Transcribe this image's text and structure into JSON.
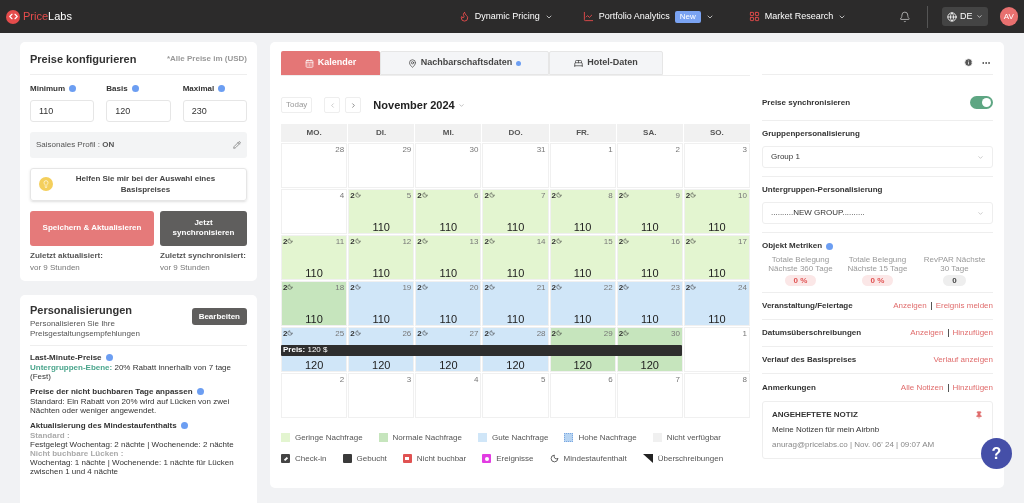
{
  "header": {
    "logo": {
      "first": "Price",
      "second": "Labs"
    },
    "nav": [
      {
        "label": "Dynamic Pricing"
      },
      {
        "label": "Portfolio Analytics",
        "badge": "New"
      },
      {
        "label": "Market Research"
      }
    ],
    "language": "DE",
    "avatar": "AV"
  },
  "configure": {
    "title": "Preise konfigurieren",
    "note": "*Alle Preise im (USD)",
    "fields": [
      {
        "label": "Minimum",
        "value": "110"
      },
      {
        "label": "Basis",
        "value": "120"
      },
      {
        "label": "Maximal",
        "value": "230"
      }
    ],
    "seasonal": {
      "label": "Saisonales Profil :",
      "value": "ON"
    },
    "help_button": "Helfen Sie mir bei der Auswahl eines Basispreises",
    "save_button": "Speichern & Aktualisieren",
    "sync_button": "Jetzt synchronisieren",
    "status": [
      {
        "label": "Zuletzt aktualisiert:",
        "value": "vor 9 Stunden"
      },
      {
        "label": "Zuletzt synchronisiert:",
        "value": "vor 9 Stunden"
      }
    ]
  },
  "personalization": {
    "title": "Personalisierungen",
    "subtitle": "Personalisieren Sie Ihre Preisgestaltungsempfehlungen",
    "edit_button": "Bearbeiten",
    "sections": [
      {
        "title": "Last-Minute-Preise",
        "lines": [
          {
            "kind": "highlighted",
            "highlight": "Untergruppen-Ebene:",
            "text": " 20% Rabatt innerhalb von 7 tage (Fest)"
          }
        ]
      },
      {
        "title": "Preise der nicht buchbaren Tage anpassen",
        "lines": [
          {
            "kind": "text",
            "text": "Standard: Ein Rabatt von 20% wird auf Lücken von zwei Nächten oder weniger angewendet."
          }
        ]
      },
      {
        "title": "Aktualisierung des Mindestaufenthalts",
        "lines": [
          {
            "kind": "label",
            "text": "Standard :"
          },
          {
            "kind": "text",
            "text": "Festgelegt Wochentag: 2 nächte | Wochenende: 2 nächte"
          },
          {
            "kind": "label",
            "text": "Nicht buchbare Lücken :"
          },
          {
            "kind": "text",
            "text": "Wochentag: 1 nächte | Wochenende: 1 nächte für Lücken zwischen 1 und 4 nächte"
          }
        ]
      }
    ]
  },
  "tabs": [
    {
      "label": "Kalender",
      "selected": true,
      "dot": false
    },
    {
      "label": "Nachbarschaftsdaten",
      "selected": false,
      "dot": true
    },
    {
      "label": "Hotel-Daten",
      "selected": false,
      "dot": false
    }
  ],
  "calendar": {
    "today": "Today",
    "month": "November 2024",
    "weekdays": [
      "MO.",
      "DI.",
      "MI.",
      "DO.",
      "FR.",
      "SA.",
      "SO."
    ],
    "weeks": [
      {
        "days": [
          {
            "day": "28",
            "color": "#ffffff"
          },
          {
            "day": "29",
            "color": "#ffffff"
          },
          {
            "day": "30",
            "color": "#ffffff"
          },
          {
            "day": "31",
            "color": "#ffffff"
          },
          {
            "day": "1",
            "color": "#ffffff"
          },
          {
            "day": "2",
            "color": "#ffffff"
          },
          {
            "day": "3",
            "color": "#ffffff"
          }
        ]
      },
      {
        "days": [
          {
            "day": "4",
            "color": "#ffffff"
          },
          {
            "day": "5",
            "color": "#e3f5d0",
            "min_stay": "2",
            "price": "110"
          },
          {
            "day": "6",
            "color": "#e3f5d0",
            "min_stay": "2",
            "price": "110"
          },
          {
            "day": "7",
            "color": "#e3f5d0",
            "min_stay": "2",
            "price": "110"
          },
          {
            "day": "8",
            "color": "#e3f5d0",
            "min_stay": "2",
            "price": "110"
          },
          {
            "day": "9",
            "color": "#e3f5d0",
            "min_stay": "2",
            "price": "110"
          },
          {
            "day": "10",
            "color": "#e3f5d0",
            "min_stay": "2",
            "price": "110"
          }
        ]
      },
      {
        "days": [
          {
            "day": "11",
            "color": "#e3f5d0",
            "min_stay": "2",
            "price": "110"
          },
          {
            "day": "12",
            "color": "#e3f5d0",
            "min_stay": "2",
            "price": "110"
          },
          {
            "day": "13",
            "color": "#e3f5d0",
            "min_stay": "2",
            "price": "110"
          },
          {
            "day": "14",
            "color": "#e3f5d0",
            "min_stay": "2",
            "price": "110"
          },
          {
            "day": "15",
            "color": "#e3f5d0",
            "min_stay": "2",
            "price": "110"
          },
          {
            "day": "16",
            "color": "#e3f5d0",
            "min_stay": "2",
            "price": "110"
          },
          {
            "day": "17",
            "color": "#e3f5d0",
            "min_stay": "2",
            "price": "110"
          }
        ]
      },
      {
        "days": [
          {
            "day": "18",
            "color": "#c6e5bd",
            "min_stay": "2",
            "price": "110"
          },
          {
            "day": "19",
            "color": "#d0e6f8",
            "min_stay": "2",
            "price": "110"
          },
          {
            "day": "20",
            "color": "#d0e6f8",
            "min_stay": "2",
            "price": "110"
          },
          {
            "day": "21",
            "color": "#d0e6f8",
            "min_stay": "2",
            "price": "110"
          },
          {
            "day": "22",
            "color": "#d0e6f8",
            "min_stay": "2",
            "price": "110"
          },
          {
            "day": "23",
            "color": "#d0e6f8",
            "min_stay": "2",
            "price": "110"
          },
          {
            "day": "24",
            "color": "#d0e6f8",
            "min_stay": "2",
            "price": "110"
          }
        ]
      },
      {
        "price_bar": "**Preis:** 120 $",
        "days": [
          {
            "day": "25",
            "color": "#d0e6f8",
            "min_stay": "2",
            "price": "120"
          },
          {
            "day": "26",
            "color": "#d0e6f8",
            "min_stay": "2",
            "price": "120"
          },
          {
            "day": "27",
            "color": "#d0e6f8",
            "min_stay": "2",
            "price": "120"
          },
          {
            "day": "28",
            "color": "#d0e6f8",
            "min_stay": "2",
            "price": "120"
          },
          {
            "day": "29",
            "color": "#c6e5bd",
            "min_stay": "2",
            "price": "120"
          },
          {
            "day": "30",
            "color": "#c6e5bd",
            "min_stay": "2",
            "price": "120"
          },
          {
            "day": "1",
            "color": "#ffffff"
          }
        ]
      },
      {
        "days": [
          {
            "day": "2",
            "color": "#ffffff"
          },
          {
            "day": "3",
            "color": "#ffffff"
          },
          {
            "day": "4",
            "color": "#ffffff"
          },
          {
            "day": "5",
            "color": "#ffffff"
          },
          {
            "day": "6",
            "color": "#ffffff"
          },
          {
            "day": "7",
            "color": "#ffffff"
          },
          {
            "day": "8",
            "color": "#ffffff"
          }
        ]
      }
    ],
    "legend": [
      {
        "kind": "low",
        "label": "Geringe Nachfrage"
      },
      {
        "kind": "normal",
        "label": "Normale Nachfrage"
      },
      {
        "kind": "good",
        "label": "Gute Nachfrage"
      },
      {
        "kind": "high",
        "label": "Hohe Nachfrage"
      },
      {
        "kind": "unavailable",
        "label": "Nicht verfügbar"
      },
      {
        "kind": "checkin",
        "label": "Check-in"
      },
      {
        "kind": "booked",
        "label": "Gebucht"
      },
      {
        "kind": "unbookable",
        "label": "Nicht buchbar"
      },
      {
        "kind": "events",
        "label": "Ereignisse"
      },
      {
        "kind": "minstay",
        "label": "Mindestaufenthalt"
      },
      {
        "kind": "override",
        "label": "Überschreibungen"
      }
    ]
  },
  "side": {
    "sync": {
      "label": "Preise synchronisieren",
      "on": true
    },
    "selects": [
      {
        "label": "Gruppenpersonalisierung",
        "value": "Group 1"
      },
      {
        "label": "Untergruppen-Personalisierung",
        "value": "..........NEW GROUP.........."
      }
    ],
    "metrics": {
      "title": "Objekt Metriken",
      "items": [
        {
          "label": "Totale Belegung Nächste 360 Tage",
          "value": "0 %",
          "kind": "pct"
        },
        {
          "label": "Totale Belegung Nächste 15 Tage",
          "value": "0 %",
          "kind": "pct"
        },
        {
          "label": "RevPAR Nächste 30 Tage",
          "value": "0",
          "kind": "num"
        }
      ]
    },
    "rows": [
      {
        "label": "Veranstaltung/Feiertage",
        "links": [
          "Anzeigen",
          "Ereignis melden"
        ]
      },
      {
        "label": "Datumsüberschreibungen",
        "links": [
          "Anzeigen",
          "Hinzufügen"
        ]
      },
      {
        "label": "Verlauf des Basispreises",
        "links": [
          "Verlauf anzeigen"
        ]
      },
      {
        "label": "Anmerkungen",
        "links": [
          "Alle Notizen",
          "Hinzufügen"
        ]
      }
    ],
    "note": {
      "heading": "ANGEHEFTETE NOTIZ",
      "text": "Meine Notizen für mein Airbnb",
      "meta": "anurag@pricelabs.co | Nov. 06' 24 | 09:07 AM"
    }
  },
  "help_fab": "?"
}
